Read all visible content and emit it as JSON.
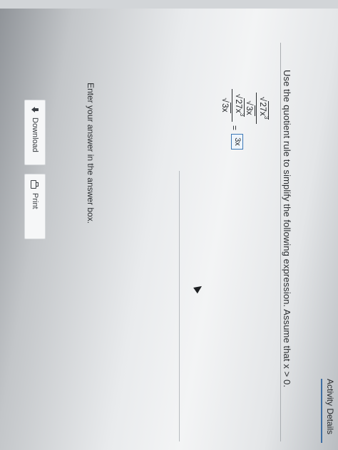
{
  "question": {
    "instruction": "Use the quotient rule to simplify the following expression. Assume that x > 0.",
    "expression_num": "27x",
    "expression_exp": "3",
    "expression_den": "3x",
    "equals": "=",
    "answer_value": "3x",
    "enter_text": "Enter your answer in the answer box."
  },
  "actions": {
    "download_label": "Download",
    "print_label": "Print"
  },
  "footer": {
    "activity_details": "Activity Details"
  }
}
